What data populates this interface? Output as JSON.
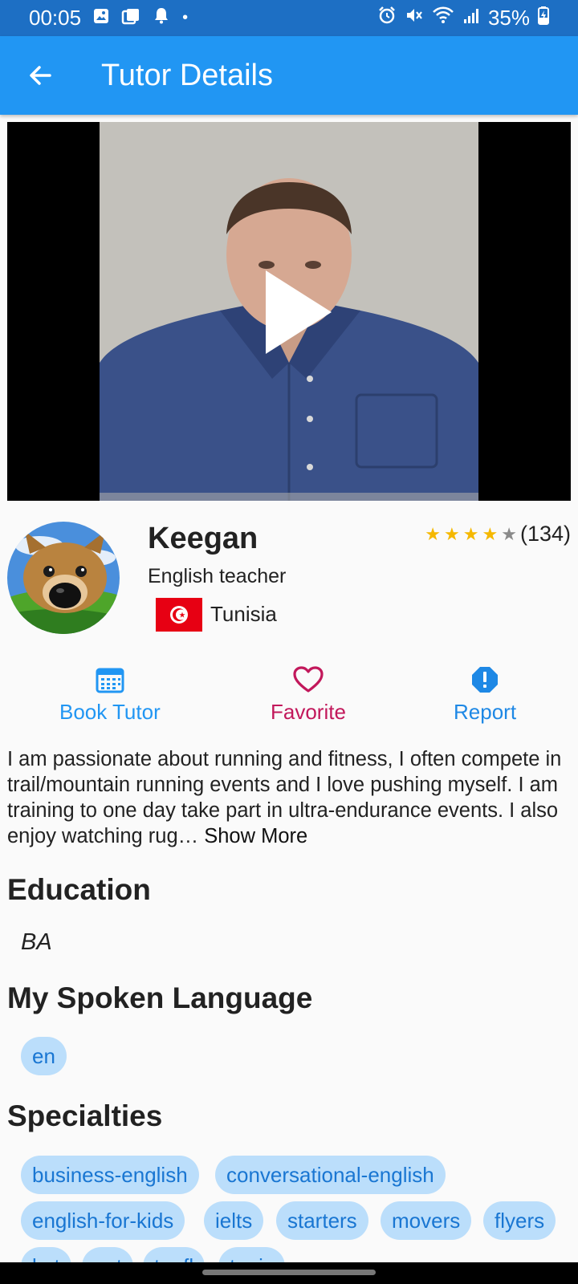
{
  "status_bar": {
    "time": "00:05",
    "battery": "35%",
    "dot": "•"
  },
  "app_bar": {
    "title": "Tutor Details",
    "back_icon": "arrow-back-icon"
  },
  "video": {
    "play_icon": "play-icon"
  },
  "tutor": {
    "name": "Keegan",
    "role": "English teacher",
    "country": "Tunisia",
    "rating_stars": 4,
    "rating_max": 5,
    "rating_count": "(134)"
  },
  "actions": {
    "book_label": "Book Tutor",
    "favorite_label": "Favorite",
    "report_label": "Report"
  },
  "about": {
    "text": "I am passionate about running and fitness, I often compete in trail/mountain running events and I love pushing myself. I am training to one day take part in ultra-endurance events. I also enjoy watching rug…",
    "show_more": "Show More"
  },
  "education": {
    "title": "Education",
    "value": "BA"
  },
  "languages": {
    "title": "My Spoken Language",
    "items": [
      "en"
    ]
  },
  "specialties": {
    "title": "Specialties",
    "items": [
      "business-english",
      "conversational-english",
      "english-for-kids",
      "ielts",
      "starters",
      "movers",
      "flyers",
      "ket",
      "pet",
      "toefl",
      "toeic"
    ]
  },
  "colors": {
    "app_bar": "#2196f3",
    "status_bar": "#1d6fc4",
    "book": "#2196f3",
    "favorite": "#c2185b",
    "report": "#1e88e5",
    "chip_bg": "#bbdefb",
    "chip_text": "#1976d2",
    "star": "#f5b800",
    "star_empty": "#8a8a8a"
  }
}
